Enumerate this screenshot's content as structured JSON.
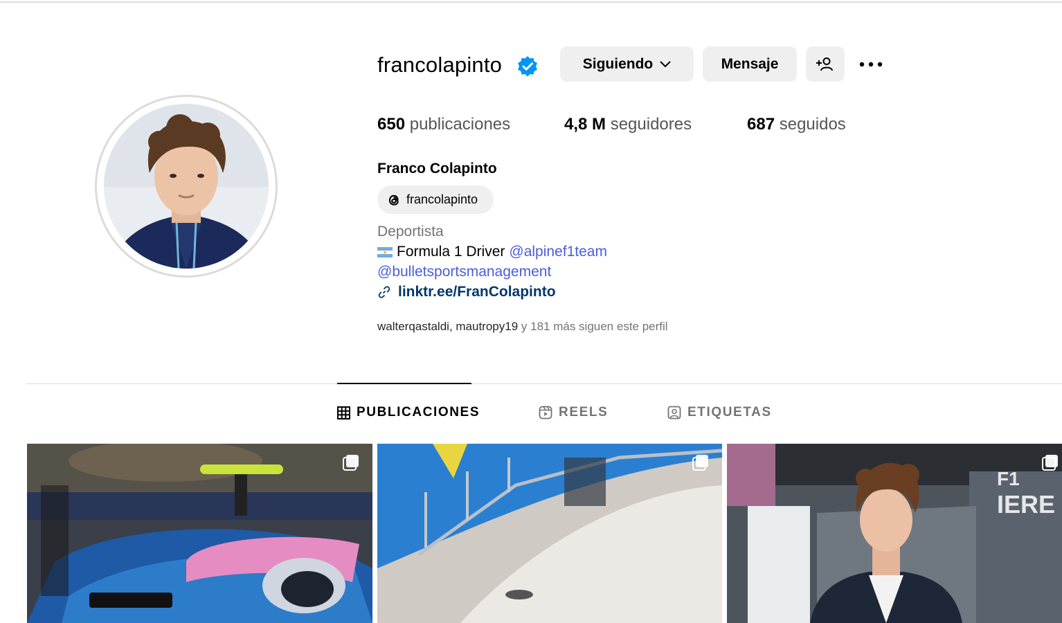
{
  "profile": {
    "username": "francolapinto",
    "full_name": "Franco Colapinto",
    "threads_handle": "francolapinto",
    "category": "Deportista",
    "bio_line1_text": "Formula 1 Driver",
    "bio_line1_mention": "@alpinef1team",
    "bio_line2_mention": "@bulletsportsmanagement",
    "link": "linktr.ee/FranColapinto",
    "followed_by_names": "walterqastaldi, mautropy19",
    "followed_by_rest": " y 181 más siguen este perfil"
  },
  "actions": {
    "following_label": "Siguiendo",
    "message_label": "Mensaje"
  },
  "stats": {
    "posts_count": "650",
    "posts_label": "publicaciones",
    "followers_count": "4,8 M",
    "followers_label": "seguidores",
    "following_count": "687",
    "following_label": "seguidos"
  },
  "tabs": [
    {
      "label": "PUBLICACIONES",
      "icon": "grid-icon",
      "active": true
    },
    {
      "label": "REELS",
      "icon": "reels-icon",
      "active": false
    },
    {
      "label": "ETIQUETAS",
      "icon": "tagged-icon",
      "active": false
    }
  ],
  "colors": {
    "verified": "#0095f6",
    "mention": "#4a5dd8",
    "link": "#00376b",
    "button_bg": "#efefef"
  },
  "posts": [
    {
      "subject": "Alpine F1 car",
      "multi": true
    },
    {
      "subject": "yacht",
      "multi": true
    },
    {
      "subject": "F1 The Movie premiere",
      "multi": true
    }
  ]
}
